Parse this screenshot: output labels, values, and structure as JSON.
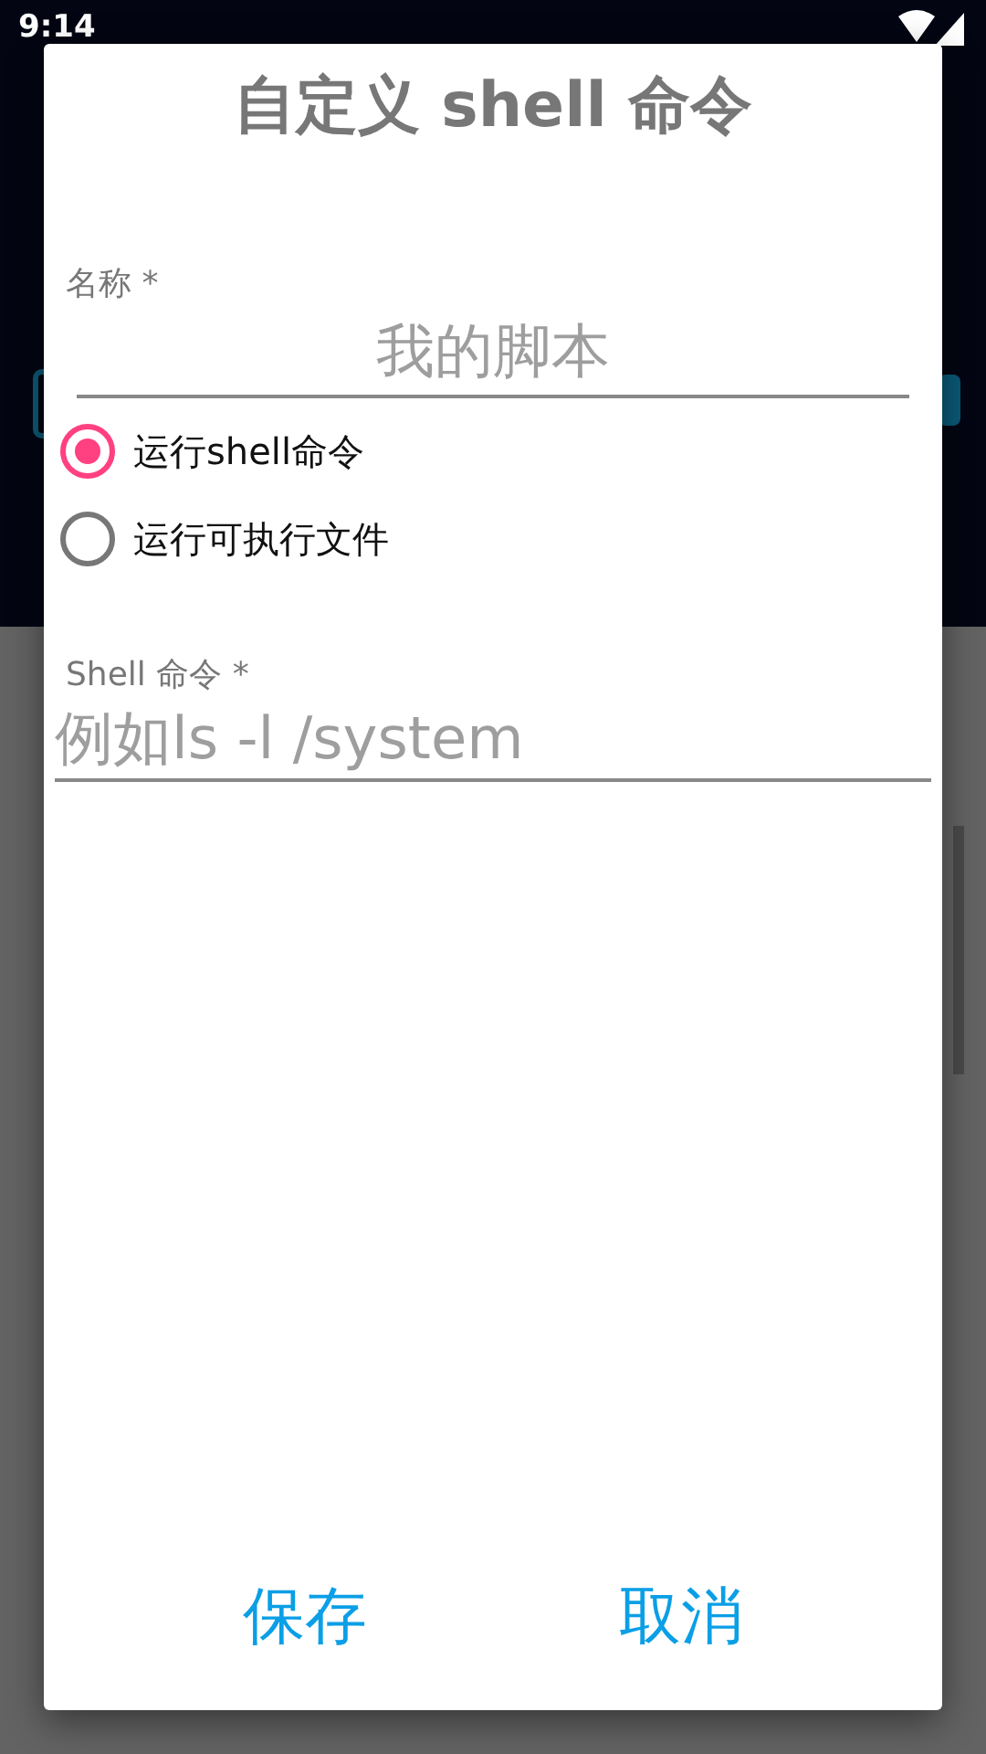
{
  "status_bar": {
    "time": "9:14"
  },
  "dialog": {
    "title": "自定义 shell 命令",
    "name_field": {
      "label": "名称 *",
      "placeholder": "我的脚本"
    },
    "options": [
      {
        "label": "运行shell命令",
        "selected": true
      },
      {
        "label": "运行可执行文件",
        "selected": false
      }
    ],
    "command_field": {
      "label": "Shell 命令 *",
      "placeholder": "例如ls -l /system"
    },
    "buttons": [
      "保存",
      "取消"
    ]
  }
}
